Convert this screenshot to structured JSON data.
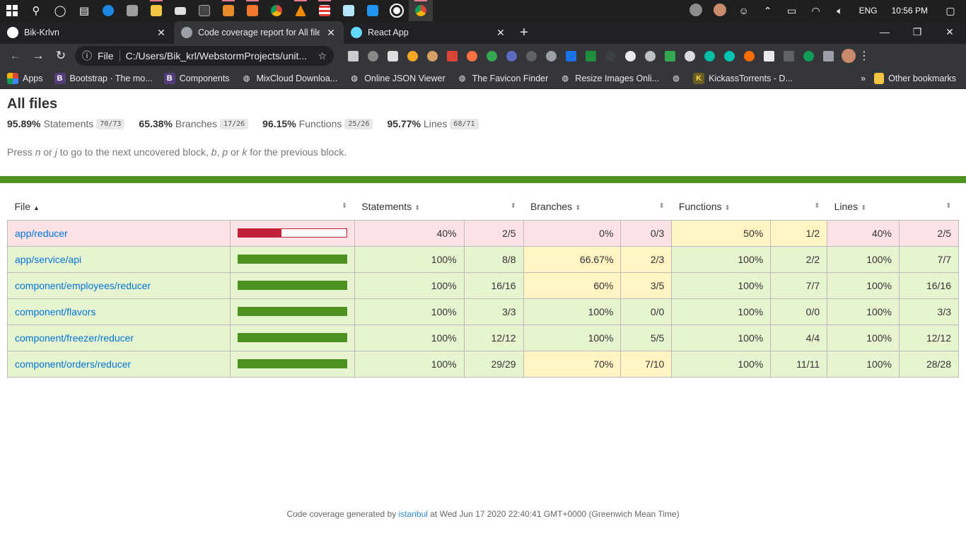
{
  "taskbar": {
    "tray": {
      "lang": "ENG",
      "time": "10:56 PM"
    }
  },
  "tabs": [
    {
      "title": "Bik-Krlvn"
    },
    {
      "title": "Code coverage report for All files"
    },
    {
      "title": "React App"
    }
  ],
  "toolbar": {
    "scheme_label": "File",
    "url": "C:/Users/Bik_krl/WebstormProjects/unit..."
  },
  "bookmarks": {
    "items": [
      {
        "label": "Apps",
        "icon": "grid-icon"
      },
      {
        "label": "Bootstrap · The mo...",
        "icon": "bootstrap-icon"
      },
      {
        "label": "Components",
        "icon": "bootstrap-icon"
      },
      {
        "label": "MixCloud Downloa...",
        "icon": "globe-icon"
      },
      {
        "label": "Online JSON Viewer",
        "icon": "globe-icon"
      },
      {
        "label": "The Favicon Finder",
        "icon": "globe-icon"
      },
      {
        "label": "Resize Images Onli...",
        "icon": "globe-icon"
      },
      {
        "label": "",
        "icon": "globe-icon"
      },
      {
        "label": "KickassTorrents - D...",
        "icon": "kickass-icon"
      }
    ],
    "overflow": "»",
    "other": "Other bookmarks"
  },
  "report": {
    "title": "All files",
    "summary": [
      {
        "pct": "95.89%",
        "label": "Statements",
        "fraction": "70/73"
      },
      {
        "pct": "65.38%",
        "label": "Branches",
        "fraction": "17/26"
      },
      {
        "pct": "96.15%",
        "label": "Functions",
        "fraction": "25/26"
      },
      {
        "pct": "95.77%",
        "label": "Lines",
        "fraction": "68/71"
      }
    ],
    "hint": {
      "p1": "Press ",
      "k1": "n",
      "p2": " or ",
      "k2": "j",
      "p3": " to go to the next uncovered block, ",
      "k3": "b",
      "p4": ", ",
      "k4": "p",
      "p5": " or ",
      "k5": "k",
      "p6": " for the previous block."
    },
    "columns": {
      "file": "File",
      "statements": "Statements",
      "branches": "Branches",
      "functions": "Functions",
      "lines": "Lines"
    },
    "rows": [
      {
        "file": "app/reducer",
        "bar": 0.4,
        "stmt_pct": "40%",
        "stmt": "2/5",
        "br_pct": "0%",
        "br": "0/3",
        "fn_pct": "50%",
        "fn": "1/2",
        "ln_pct": "40%",
        "ln": "2/5",
        "level": "low",
        "br_level": "low",
        "fn_level": "mid",
        "ln_level": "low"
      },
      {
        "file": "app/service/api",
        "bar": 1.0,
        "stmt_pct": "100%",
        "stmt": "8/8",
        "br_pct": "66.67%",
        "br": "2/3",
        "fn_pct": "100%",
        "fn": "2/2",
        "ln_pct": "100%",
        "ln": "7/7",
        "level": "high",
        "br_level": "mid",
        "fn_level": "high",
        "ln_level": "high"
      },
      {
        "file": "component/employees/reducer",
        "bar": 1.0,
        "stmt_pct": "100%",
        "stmt": "16/16",
        "br_pct": "60%",
        "br": "3/5",
        "fn_pct": "100%",
        "fn": "7/7",
        "ln_pct": "100%",
        "ln": "16/16",
        "level": "high",
        "br_level": "mid",
        "fn_level": "high",
        "ln_level": "high"
      },
      {
        "file": "component/flavors",
        "bar": 1.0,
        "stmt_pct": "100%",
        "stmt": "3/3",
        "br_pct": "100%",
        "br": "0/0",
        "fn_pct": "100%",
        "fn": "0/0",
        "ln_pct": "100%",
        "ln": "3/3",
        "level": "high",
        "br_level": "high",
        "fn_level": "high",
        "ln_level": "high"
      },
      {
        "file": "component/freezer/reducer",
        "bar": 1.0,
        "stmt_pct": "100%",
        "stmt": "12/12",
        "br_pct": "100%",
        "br": "5/5",
        "fn_pct": "100%",
        "fn": "4/4",
        "ln_pct": "100%",
        "ln": "12/12",
        "level": "high",
        "br_level": "high",
        "fn_level": "high",
        "ln_level": "high"
      },
      {
        "file": "component/orders/reducer",
        "bar": 1.0,
        "stmt_pct": "100%",
        "stmt": "29/29",
        "br_pct": "70%",
        "br": "7/10",
        "fn_pct": "100%",
        "fn": "11/11",
        "ln_pct": "100%",
        "ln": "28/28",
        "level": "high",
        "br_level": "mid",
        "fn_level": "high",
        "ln_level": "high"
      }
    ],
    "footer": {
      "prefix": "Code coverage generated by ",
      "link": "istanbul",
      "suffix": " at Wed Jun 17 2020 22:40:41 GMT+0000 (Greenwich Mean Time)"
    }
  },
  "colors": {
    "high": "#e6f5d0",
    "medium": "#fff4c2",
    "low": "#fce1e5",
    "bar_green": "#4d9221",
    "bar_red": "#c21f39",
    "link": "#0074d9"
  }
}
